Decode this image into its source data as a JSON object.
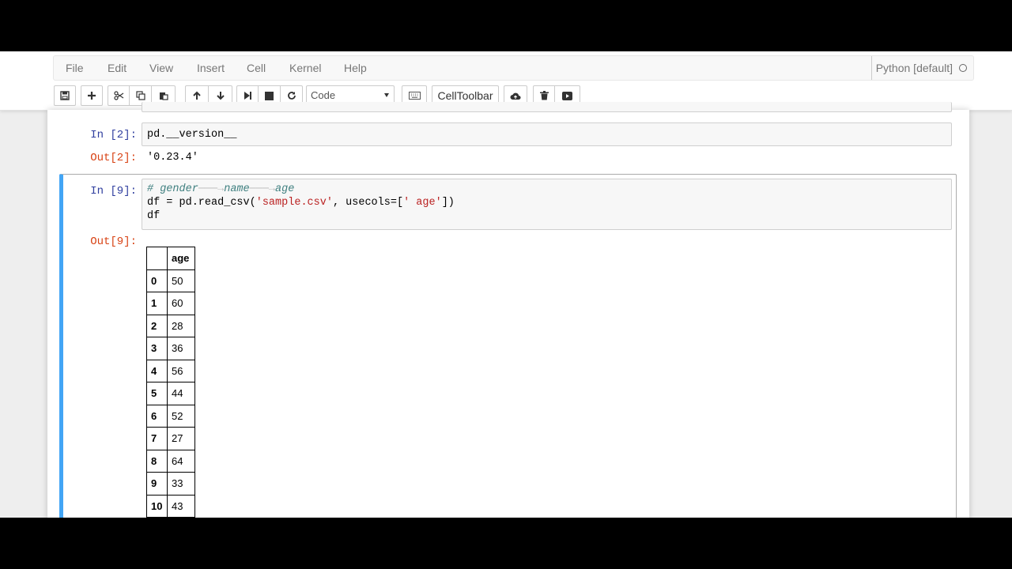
{
  "menu": {
    "items": [
      "File",
      "Edit",
      "View",
      "Insert",
      "Cell",
      "Kernel",
      "Help"
    ],
    "kernel_name": "Python [default]"
  },
  "toolbar": {
    "cell_type": "Code",
    "celltoolbar_label": "CellToolbar"
  },
  "cells": {
    "c2": {
      "in_prompt": "In [2]:",
      "code": "pd.__version__",
      "out_prompt": "Out[2]:",
      "output": "'0.23.4'"
    },
    "c9": {
      "in_prompt": "In [9]:",
      "comment_gender": "# gender",
      "comment_name": "name",
      "comment_age": "age",
      "line2_pre": "df = pd.read_csv(",
      "line2_str1": "'sample.csv'",
      "line2_mid": ", usecols=[",
      "line2_str2": "' age'",
      "line2_post": "])",
      "line3": "df",
      "out_prompt": "Out[9]:"
    }
  },
  "dataframe": {
    "columns": [
      "",
      "age"
    ],
    "rows": [
      [
        "0",
        "50"
      ],
      [
        "1",
        "60"
      ],
      [
        "2",
        "28"
      ],
      [
        "3",
        "36"
      ],
      [
        "4",
        "56"
      ],
      [
        "5",
        "44"
      ],
      [
        "6",
        "52"
      ],
      [
        "7",
        "27"
      ],
      [
        "8",
        "64"
      ],
      [
        "9",
        "33"
      ],
      [
        "10",
        "43"
      ]
    ]
  }
}
